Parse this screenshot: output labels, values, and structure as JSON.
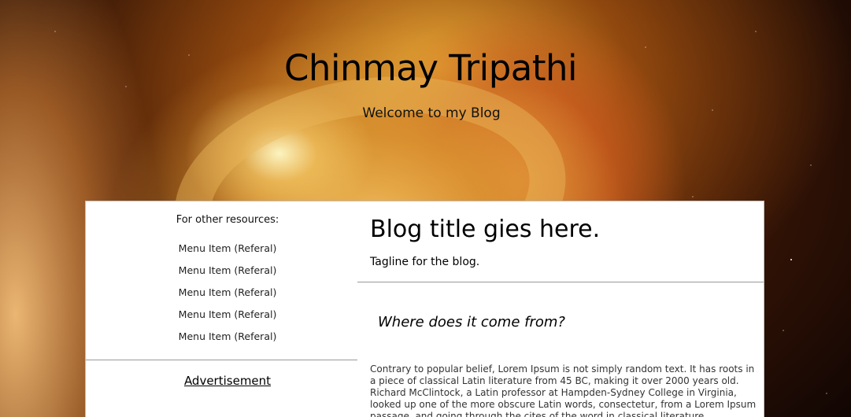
{
  "header": {
    "site_title": "Chinmay Tripathi",
    "site_subtitle": "Welcome to my Blog"
  },
  "sidebar": {
    "resources_heading": "For other resources:",
    "menu_items": [
      {
        "label": "Menu Item (Referal)"
      },
      {
        "label": "Menu Item (Referal)"
      },
      {
        "label": "Menu Item (Referal)"
      },
      {
        "label": "Menu Item (Referal)"
      },
      {
        "label": "Menu Item (Referal)"
      }
    ],
    "advertisement_heading": "Advertisement"
  },
  "main": {
    "blog_title": "Blog title gies here.",
    "blog_tagline": "Tagline for the blog.",
    "post_heading": "Where does it come from?",
    "post_body": "Contrary to popular belief, Lorem Ipsum is not simply random text. It has roots in a piece of classical Latin literature from 45 BC, making it over 2000 years old. Richard McClintock, a Latin professor at Hampden-Sydney College in Virginia, looked up one of the more obscure Latin words, consectetur, from a Lorem Ipsum passage, and going through the cites of the word in classical literature, discovered"
  }
}
